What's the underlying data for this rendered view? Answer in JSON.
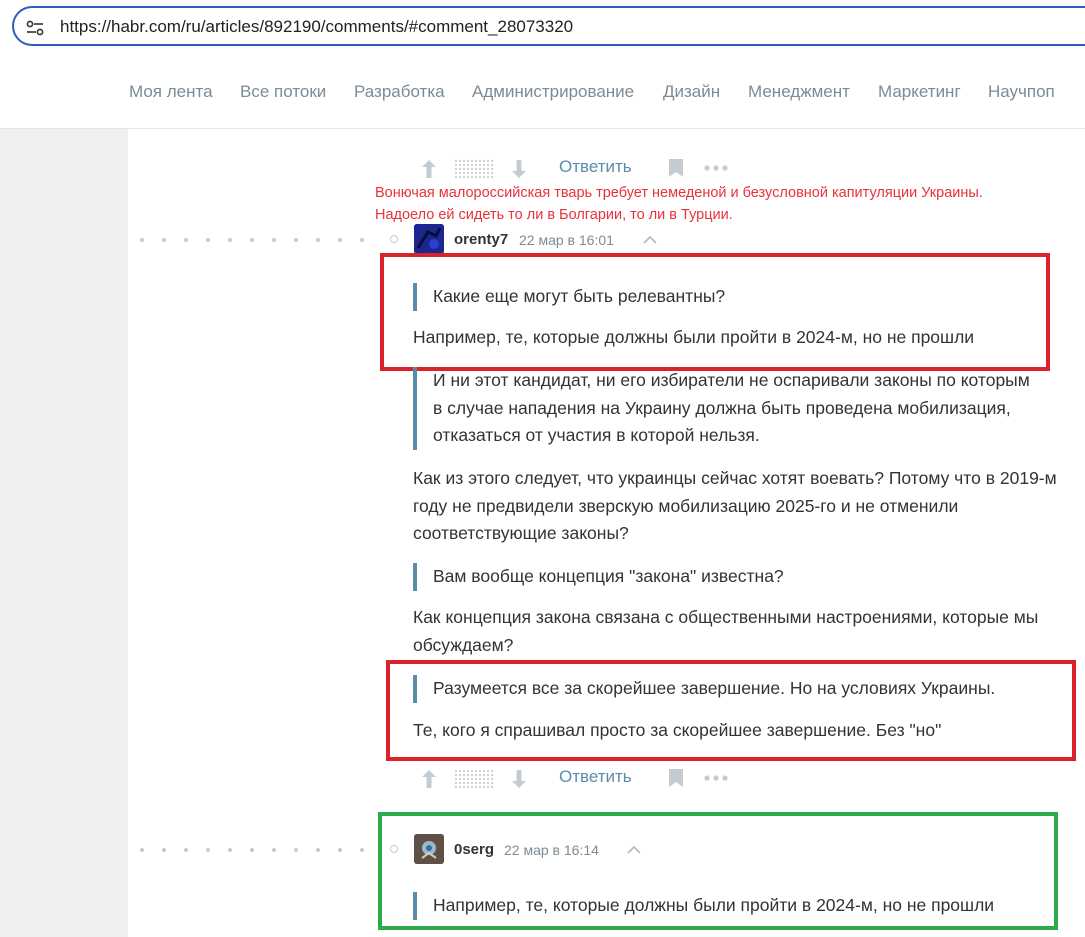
{
  "browser": {
    "url": "https://habr.com/ru/articles/892190/comments/#comment_28073320"
  },
  "nav": {
    "items": [
      "Моя лента",
      "Все потоки",
      "Разработка",
      "Администрирование",
      "Дизайн",
      "Менеджмент",
      "Маркетинг",
      "Научпоп"
    ]
  },
  "prev_comment": {
    "actions": {
      "reply": "Ответить"
    }
  },
  "overlay_note": {
    "line1": "Вонючая малороссийская тварь требует немеденой и безусловной капитуляции Украины.",
    "line2": "Надоело ей сидеть то ли в Болгарии, то ли в Турции.",
    "color": "#e8323c"
  },
  "comment1": {
    "author": "orenty7",
    "time": "22 мар в 16:01",
    "quote1": "Какие еще могут быть релевантны?",
    "para1": "Например, те, которые должны были пройти в 2024-м, но не прошли",
    "quote2": "И ни этот кандидат, ни его избиратели не оспаривали законы по которым в случае нападения на Украину должна быть проведена мобилизация, отказаться от участия в которой нельзя.",
    "para2": "Как из этого следует, что украинцы сейчас хотят воевать? Потому что в 2019-м году не предвидели зверскую мобилизацию 2025-го и не отменили соответствующие законы?",
    "quote3": "Вам вообще концепция \"закона\" известна?",
    "para3": "Как концепция закона связана с общественными настроениями, которые мы обсуждаем?",
    "quote4": "Разумеется все за скорейшее завершение. Но на условиях Украины.",
    "para4": "Те, кого я спрашивал просто за скорейшее завершение. Без \"но\"",
    "actions": {
      "reply": "Ответить"
    }
  },
  "comment2": {
    "author": "0serg",
    "time": "22 мар в 16:14",
    "quote1": "Например, те, которые должны были пройти в 2024-м, но не прошли"
  },
  "colors": {
    "accent_link": "#5a8cac",
    "quote_bar": "#5d8aa8",
    "highlight_red": "#d8232a",
    "highlight_green": "#2bab4a"
  }
}
